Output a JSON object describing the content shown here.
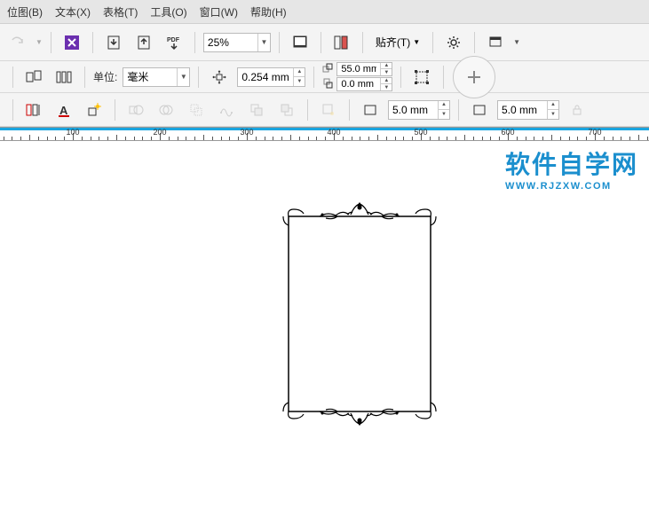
{
  "menu": {
    "bitmap": "位图(B)",
    "text": "文本(X)",
    "table": "表格(T)",
    "tools": "工具(O)",
    "window": "窗口(W)",
    "help": "帮助(H)"
  },
  "toolbar1": {
    "zoom": "25%",
    "snap_label": "贴齐(T)"
  },
  "toolbar2": {
    "units_label": "单位:",
    "units_value": "毫米",
    "nudge": "0.254 mm",
    "dup_x": "55.0 mm",
    "dup_y": "0.0 mm"
  },
  "toolbar3": {
    "outline1": "5.0 mm",
    "outline2": "5.0 mm"
  },
  "ruler": {
    "ticks": [
      "100",
      "200",
      "300",
      "400",
      "500",
      "600",
      "700"
    ]
  },
  "watermark": {
    "title": "软件自学网",
    "url": "WWW.RJZXW.COM"
  }
}
